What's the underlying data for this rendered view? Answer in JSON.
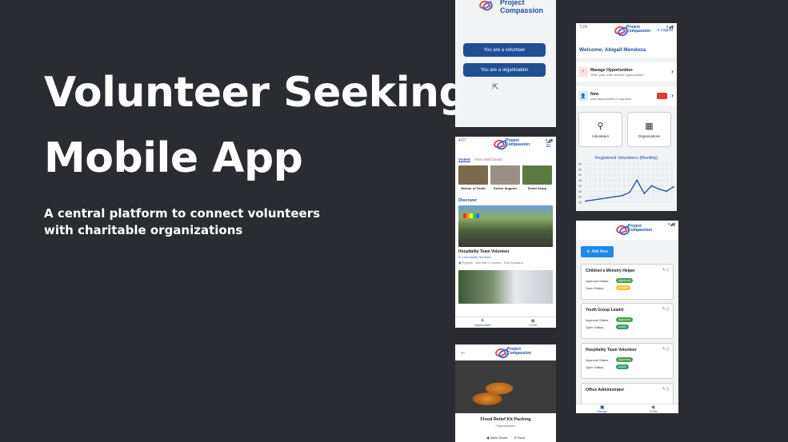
{
  "slide": {
    "title_line1": "Volunteer Seeking",
    "title_line2": "Mobile App",
    "subtitle": "A central platform to connect volunteers with charitable organizations"
  },
  "login_screen": {
    "logo_text_line1": "Project",
    "logo_text_line2": "Compassion",
    "volunteer_button": "You are a volunteer",
    "organisation_button": "You are a organisation"
  },
  "admin_screen": {
    "status_time": "7:24",
    "logo_text_line1": "Project",
    "logo_text_line2": "Compassion",
    "logout": "Logout",
    "welcome": "Welcome, Abigail Mendoza",
    "manage_title": "Manage Opportunities",
    "manage_desc": "View, post, edit, remove opportunities",
    "new_title": "New",
    "new_desc": "new opportunities to approve",
    "volunteers_tile": "Volunteers",
    "organisations_tile": "Organisations",
    "chart_title": "Registered Volunteers (Monthly)"
  },
  "chart_data": {
    "type": "line",
    "title": "Registered Volunteers (Monthly)",
    "y_ticks": [
      "60",
      "55",
      "50",
      "45",
      "40",
      "35",
      "30",
      "25"
    ],
    "values": [
      26,
      27,
      28,
      29,
      30,
      31,
      34,
      45,
      33,
      40,
      37,
      35,
      39
    ],
    "ylim": [
      25,
      60
    ]
  },
  "explore_screen": {
    "status_time": "4:07",
    "logo_text_line1": "Project",
    "logo_text_line2": "Compassion",
    "tab_visited": "Visited",
    "tab_past": "Past Visit/Closed",
    "visited": [
      {
        "label": "Mentor of Youth",
        "color": "#7a6a4e"
      },
      {
        "label": "Senior Support",
        "color": "#9a8f84"
      },
      {
        "label": "Event Setup",
        "color": "#5c7a46"
      }
    ],
    "discover": "Discover",
    "opp_title": "Hospitality Team Volunteer",
    "opp_category": "Community Services",
    "opp_details": "Regular · less than 6 months  ·  East Auckland",
    "nav_opportunities": "Opportunities",
    "nav_profile": "Profile"
  },
  "manage_screen": {
    "logo_text_line1": "Project",
    "logo_text_line2": "Compassion",
    "add_new": "Add New",
    "approval_label": "Approval Status:",
    "open_label": "Open Status:",
    "cards": [
      {
        "title": "Children's Ministry Helper",
        "approval": "Approved",
        "open": "Inactive",
        "open_color": "#fbc02d"
      },
      {
        "title": "Youth Group Leader",
        "approval": "Approved",
        "open": "Active",
        "open_color": "#2e9e6e"
      },
      {
        "title": "Hospitality Team Volunteer",
        "approval": "Approved",
        "open": "Active",
        "open_color": "#2e9e6e"
      },
      {
        "title": "Office Administrator",
        "approval": "",
        "open": "",
        "open_color": "#2e9e6e"
      }
    ],
    "nav_manage": "Manage",
    "nav_profile": "Profile"
  },
  "detail_screen": {
    "logo_text_line1": "Project",
    "logo_text_line2": "Compassion",
    "title": "Flood Relief Kit Packing",
    "organisation": "Organisation1",
    "location": "North Shore",
    "category": "Food"
  }
}
